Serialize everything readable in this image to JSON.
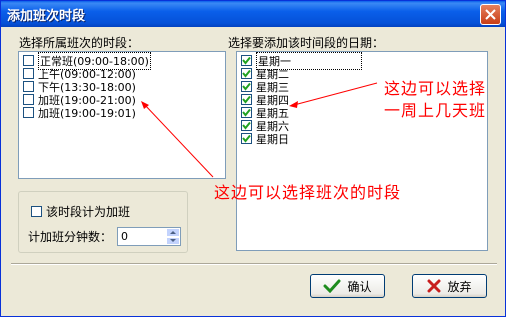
{
  "window": {
    "title": "添加班次时段"
  },
  "left": {
    "label": "选择所属班次的时段：",
    "shifts": [
      {
        "label": "正常班(09:00-18:00)",
        "checked": false,
        "focused": true
      },
      {
        "label": "上午(09:00-12:00)",
        "checked": false
      },
      {
        "label": "下午(13:30-18:00)",
        "checked": false
      },
      {
        "label": "加班(19:00-21:00)",
        "checked": false
      },
      {
        "label": "加班(19:00-19:01)",
        "checked": false
      }
    ],
    "overtime_checkbox": {
      "label": "该时段计为加班",
      "checked": false
    },
    "overtime_minutes": {
      "label": "计加班分钟数：",
      "value": "0"
    }
  },
  "right": {
    "label": "选择要添加该时间段的日期：",
    "days": [
      {
        "label": "星期一",
        "checked": true,
        "focused": true
      },
      {
        "label": "星期二",
        "checked": true
      },
      {
        "label": "星期三",
        "checked": true
      },
      {
        "label": "星期四",
        "checked": true
      },
      {
        "label": "星期五",
        "checked": true
      },
      {
        "label": "星期六",
        "checked": true
      },
      {
        "label": "星期日",
        "checked": true
      }
    ]
  },
  "annotations": {
    "days_note_line1": "这边可以选择",
    "days_note_line2": "一周上几天班",
    "shifts_note": "这边可以选择班次的时段"
  },
  "buttons": {
    "ok": "确认",
    "cancel": "放弃"
  },
  "colors": {
    "annotation": "#FF0000",
    "titlebar": "#0A5FEA"
  }
}
